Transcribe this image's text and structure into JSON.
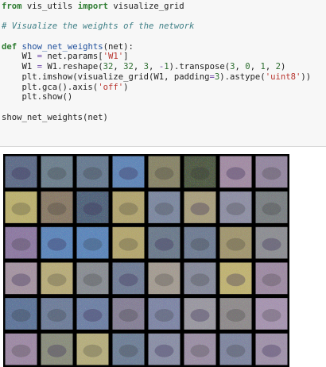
{
  "code_cell": {
    "lines": [
      [
        {
          "t": "from",
          "c": "kw"
        },
        {
          "t": " vis_utils "
        },
        {
          "t": "import",
          "c": "kw"
        },
        {
          "t": " visualize_grid"
        }
      ],
      [],
      [
        {
          "t": "# Visualize the weights of the network",
          "c": "cm"
        }
      ],
      [],
      [
        {
          "t": "def",
          "c": "kw"
        },
        {
          "t": " "
        },
        {
          "t": "show_net_weights",
          "c": "fn"
        },
        {
          "t": "(net):"
        }
      ],
      [
        {
          "t": "    W1 "
        },
        {
          "t": "=",
          "c": "op"
        },
        {
          "t": " net.params["
        },
        {
          "t": "'W1'",
          "c": "str"
        },
        {
          "t": "]"
        }
      ],
      [
        {
          "t": "    W1 "
        },
        {
          "t": "=",
          "c": "op"
        },
        {
          "t": " W1.reshape("
        },
        {
          "t": "32",
          "c": "num"
        },
        {
          "t": ", "
        },
        {
          "t": "32",
          "c": "num"
        },
        {
          "t": ", "
        },
        {
          "t": "3",
          "c": "num"
        },
        {
          "t": ", "
        },
        {
          "t": "-",
          "c": "op"
        },
        {
          "t": "1",
          "c": "num"
        },
        {
          "t": ").transpose("
        },
        {
          "t": "3",
          "c": "num"
        },
        {
          "t": ", "
        },
        {
          "t": "0",
          "c": "num"
        },
        {
          "t": ", "
        },
        {
          "t": "1",
          "c": "num"
        },
        {
          "t": ", "
        },
        {
          "t": "2",
          "c": "num"
        },
        {
          "t": ")"
        }
      ],
      [
        {
          "t": "    plt.imshow(visualize_grid(W1, padding"
        },
        {
          "t": "=",
          "c": "op"
        },
        {
          "t": "3",
          "c": "num"
        },
        {
          "t": ").astype("
        },
        {
          "t": "'uint8'",
          "c": "str"
        },
        {
          "t": "))"
        }
      ],
      [
        {
          "t": "    plt.gca().axis("
        },
        {
          "t": "'off'",
          "c": "str"
        },
        {
          "t": ")"
        }
      ],
      [
        {
          "t": "    plt.show()"
        }
      ],
      [],
      [
        {
          "t": "show_net_weights(net)"
        }
      ]
    ]
  },
  "output": {
    "tile_colors": [
      [
        "#5c6b88",
        "#6c7f8e",
        "#667a91",
        "#5e86b8",
        "#888466",
        "#4c573f",
        "#a28ca4",
        "#9487a0"
      ],
      [
        "#bcb16e",
        "#897a65",
        "#4d617a",
        "#b1a46e",
        "#7c88a0",
        "#a99f7d",
        "#8e8fa4",
        "#7a7f82"
      ],
      [
        "#8d79a2",
        "#5b86bb",
        "#5a86bb",
        "#b4a76e",
        "#6b7a8c",
        "#6e7c93",
        "#a1966e",
        "#8d8e93"
      ],
      [
        "#a594a2",
        "#b8ac79",
        "#898d93",
        "#707d96",
        "#a49c92",
        "#878b9c",
        "#c0b372",
        "#9e8ba3"
      ],
      [
        "#5d759a",
        "#6d7d9a",
        "#6d80a5",
        "#857f96",
        "#7e86a6",
        "#9a98a1",
        "#8f8b8c",
        "#a694b0"
      ],
      [
        "#9e8aa5",
        "#8a8d7c",
        "#b6ae7d",
        "#6e7f97",
        "#8a8fa6",
        "#9b8fa5",
        "#7f86a0",
        "#a092aa"
      ]
    ]
  }
}
